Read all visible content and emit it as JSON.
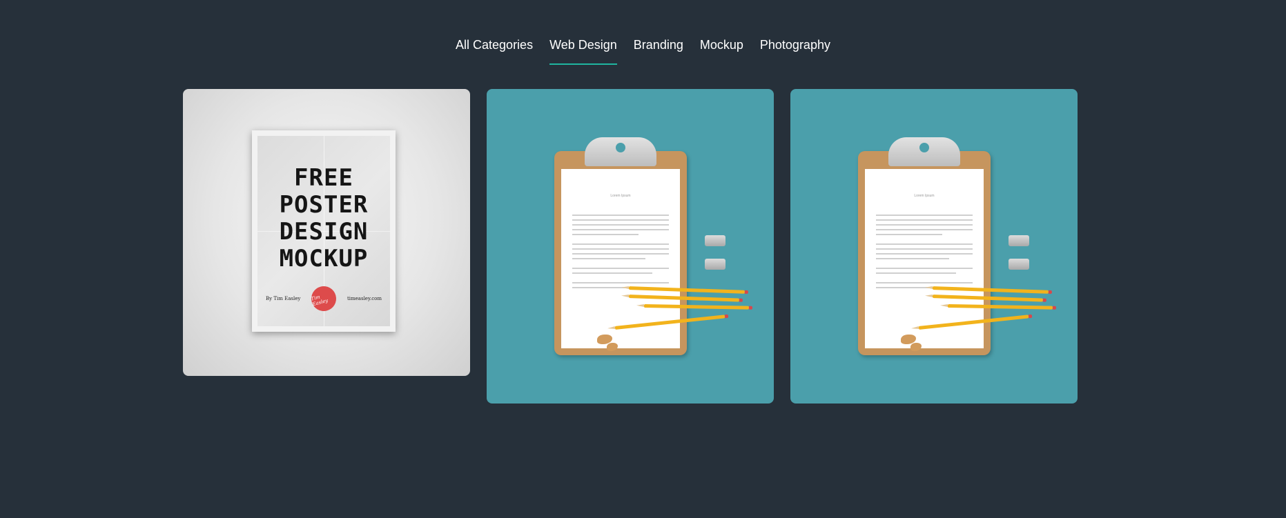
{
  "filters": [
    {
      "label": "All Categories",
      "active": false
    },
    {
      "label": "Web Design",
      "active": true
    },
    {
      "label": "Branding",
      "active": false
    },
    {
      "label": "Mockup",
      "active": false
    },
    {
      "label": "Photography",
      "active": false
    }
  ],
  "accent_color": "#1fb5a0",
  "background_color": "#26303a",
  "portfolio": [
    {
      "image": "poster-mockup",
      "poster": {
        "headline": "FREE\nPOSTER\nDESIGN\nMOCKUP",
        "author": "By Tim Easley",
        "badge": "Tim Easley",
        "site": "timeasley.com"
      }
    },
    {
      "image": "clipboard-pencils",
      "paper_heading": "Lorem Ipsum",
      "background": "#4b9fab"
    },
    {
      "image": "clipboard-pencils",
      "paper_heading": "Lorem Ipsum",
      "background": "#4b9fab"
    }
  ]
}
